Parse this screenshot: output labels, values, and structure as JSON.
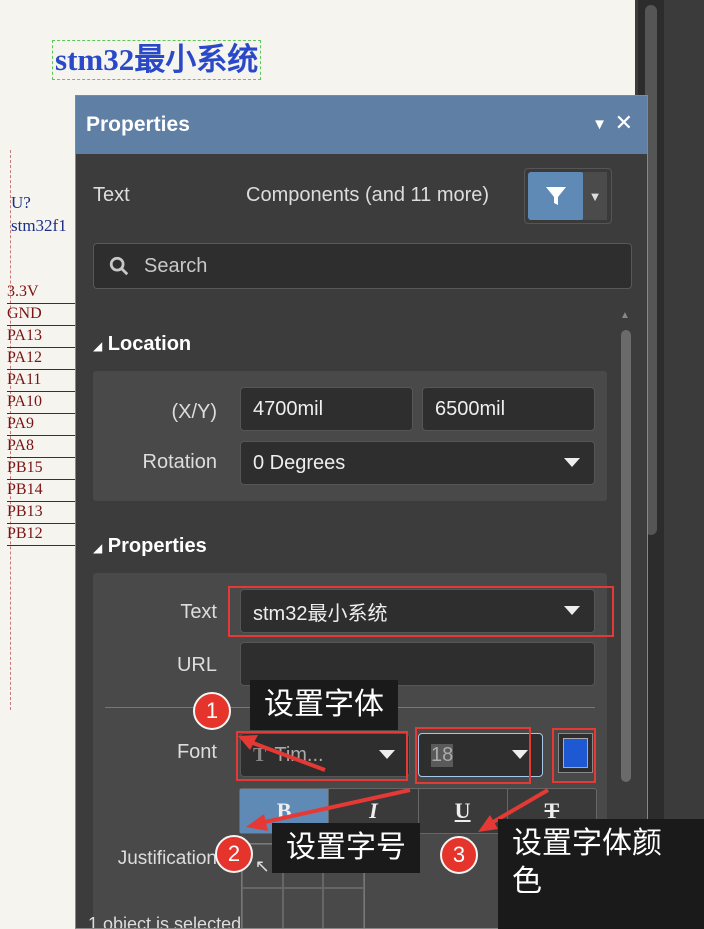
{
  "schematic": {
    "title_text": "stm32最小系统",
    "designator": "U?",
    "part": "stm32f1",
    "pins": [
      "3.3V",
      "GND",
      "PA13",
      "PA12",
      "PA11",
      "PA10",
      "PA9",
      "PA8",
      "PB15",
      "PB14",
      "PB13",
      "PB12"
    ]
  },
  "panel": {
    "title": "Properties",
    "type_label": "Text",
    "scope": "Components (and 11 more)",
    "search_placeholder": "Search",
    "location": {
      "heading": "Location",
      "xy_label": "(X/Y)",
      "x": "4700mil",
      "y": "6500mil",
      "rotation_label": "Rotation",
      "rotation": "0 Degrees"
    },
    "properties": {
      "heading": "Properties",
      "text_label": "Text",
      "text_value": "stm32最小系统",
      "url_label": "URL",
      "url_value": "",
      "font_label": "Font",
      "font_value": "Tim...",
      "font_size": "18",
      "font_color": "#1e58d2",
      "bold": "B",
      "italic": "I",
      "underline": "U",
      "strike": "T",
      "justification_label": "Justification"
    },
    "status": "1 object is selected"
  },
  "annotations": {
    "badge1": "1",
    "badge2": "2",
    "badge3": "3",
    "callout1": "设置字体",
    "callout2": "设置字号",
    "callout3": "设置字体颜色"
  }
}
